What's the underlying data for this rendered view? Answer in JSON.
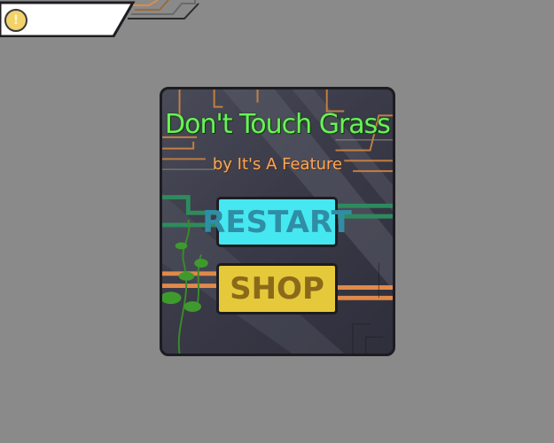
{
  "hud": {
    "coin_symbol": "!",
    "coin_count": ""
  },
  "menu": {
    "title": "Don't Touch Grass",
    "subtitle": "by It's A Feature",
    "restart_label": "RESTART",
    "shop_label": "SHOP"
  },
  "colors": {
    "background": "#8a8a8a",
    "title": "#6bf05a",
    "subtitle": "#f6a85a",
    "restart": "#45e8f0",
    "shop": "#e6c93a"
  }
}
